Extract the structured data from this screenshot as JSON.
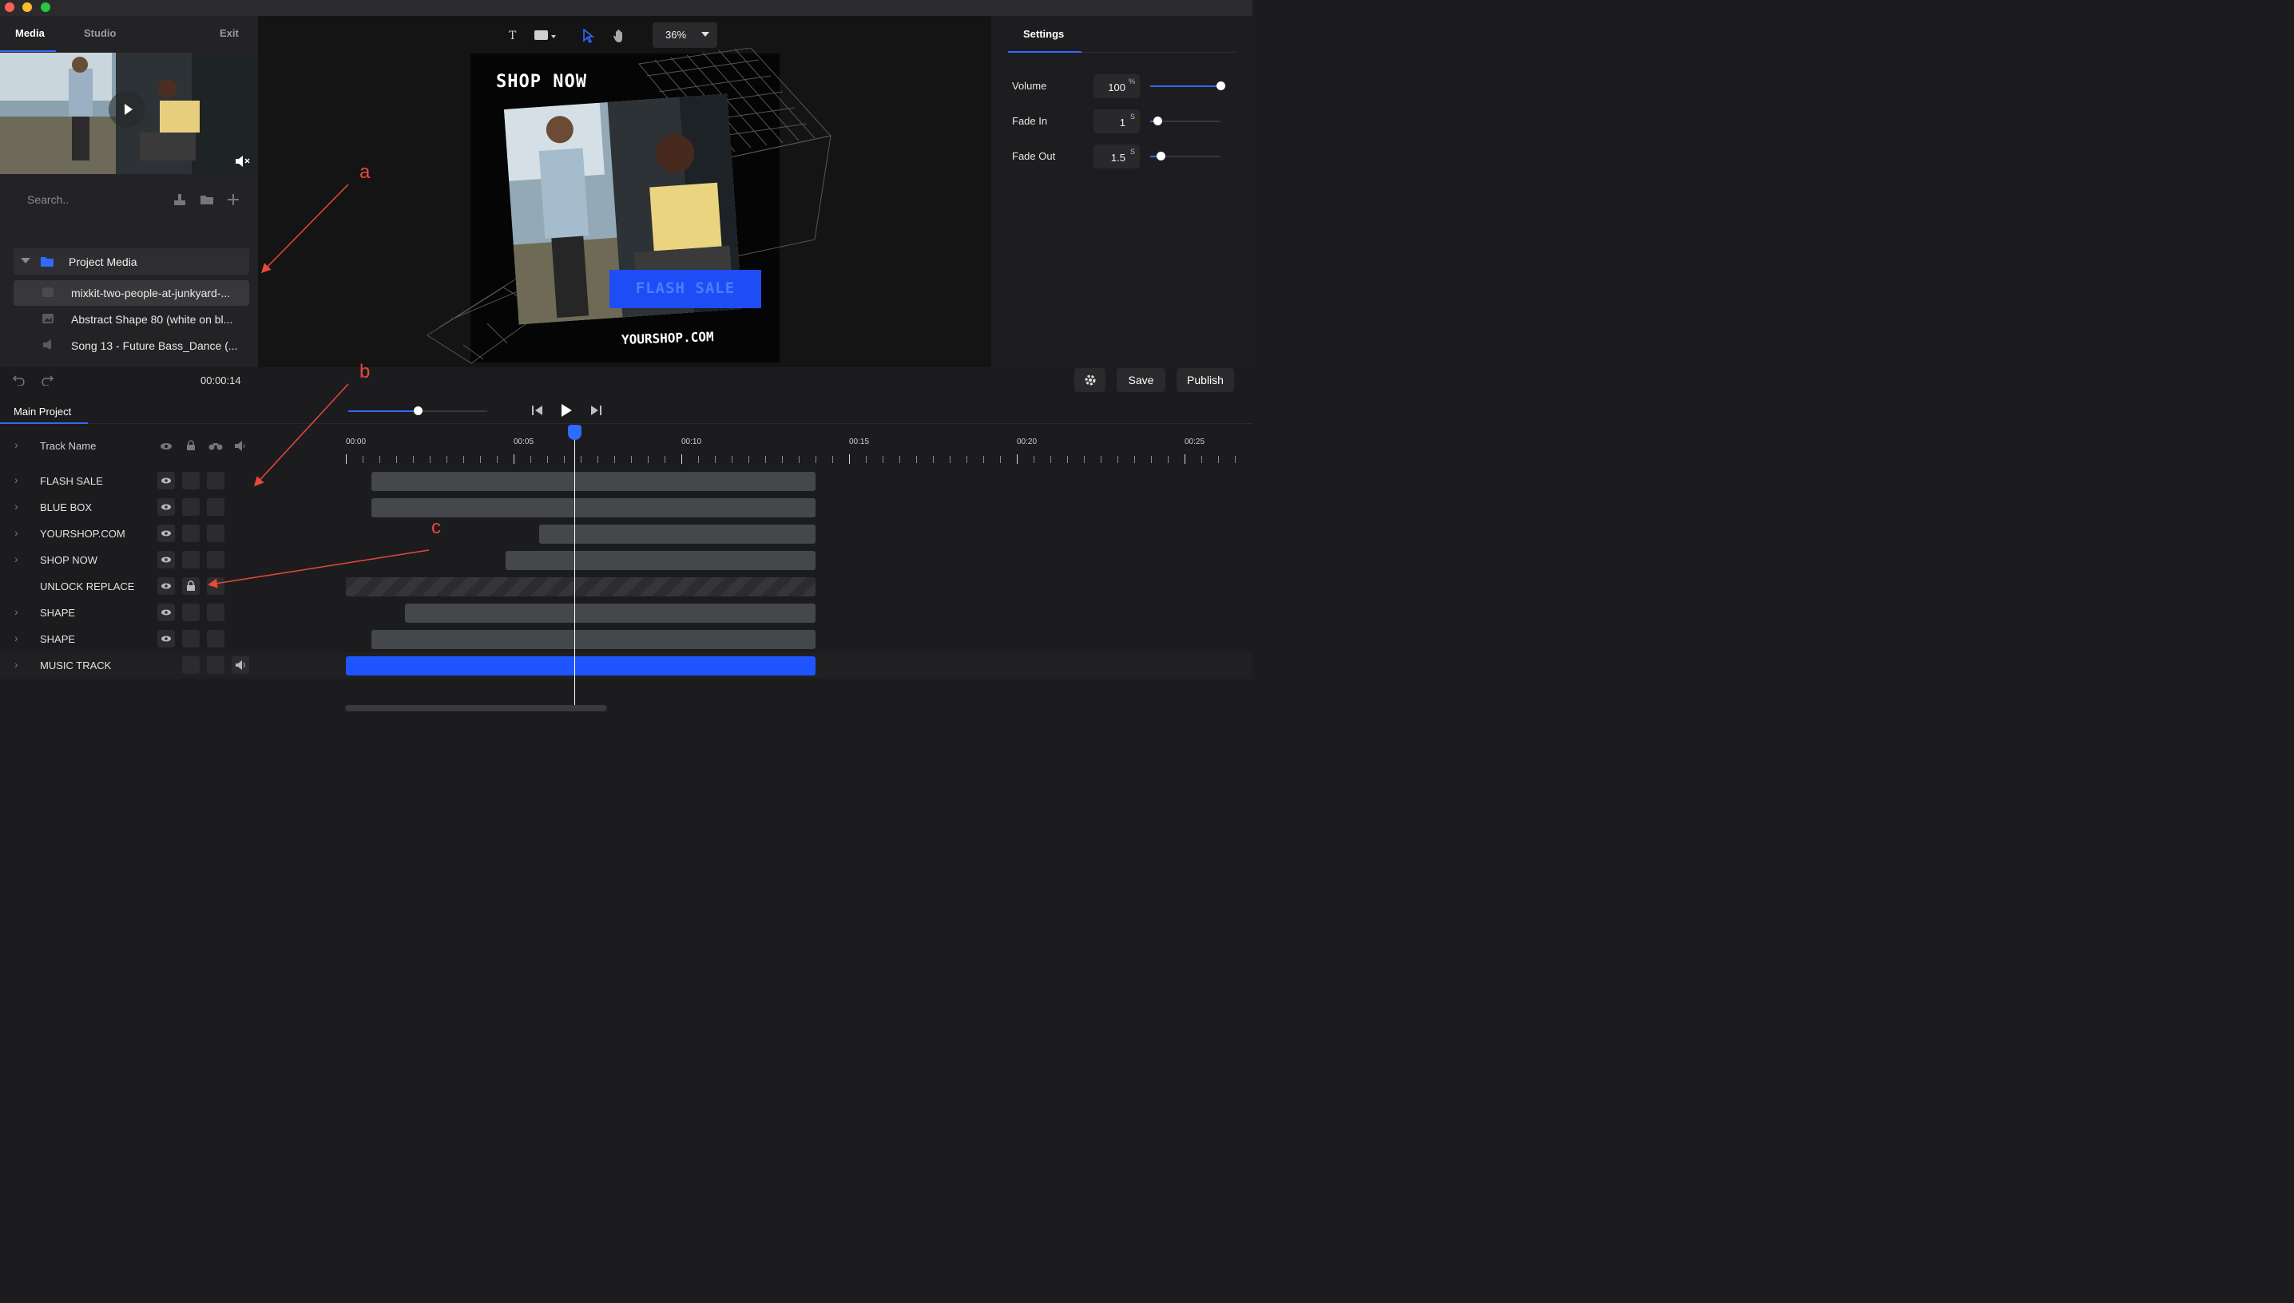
{
  "left_panel": {
    "tabs": [
      {
        "label": "Media"
      },
      {
        "label": "Studio"
      }
    ],
    "exit_label": "Exit",
    "search_placeholder": "Search..",
    "folder": {
      "label": "Project Media"
    },
    "files": [
      {
        "label": "mixkit-two-people-at-junkyard-...",
        "icon": "video-icon"
      },
      {
        "label": "Abstract Shape 80 (white on bl...",
        "icon": "image-icon"
      },
      {
        "label": "Song 13 - Future Bass_Dance (...",
        "icon": "audio-icon"
      }
    ]
  },
  "canvas": {
    "toolbar": {
      "text_tool": "T",
      "zoom": "36%"
    },
    "artboard": {
      "headline": "SHOP  NOW",
      "flash": "FLASH SALE",
      "url": "YOURSHOP.COM"
    }
  },
  "settings": {
    "tab": "Settings",
    "props": [
      {
        "label": "Volume",
        "value": "100",
        "unit": "%",
        "level": 1.0
      },
      {
        "label": "Fade In",
        "value": "1",
        "unit": "S",
        "level": 0.1
      },
      {
        "label": "Fade Out",
        "value": "1.5",
        "unit": "S",
        "level": 0.15
      }
    ]
  },
  "timeline": {
    "time": "00:00:14",
    "tab": "Main Project",
    "save_label": "Save",
    "publish_label": "Publish",
    "header_label": "Track Name",
    "zoom_level": 0.5,
    "ruler": [
      "00:00",
      "00:05",
      "00:10",
      "00:15",
      "00:20",
      "00:25"
    ],
    "playhead_seconds": 6.8,
    "tracks": [
      {
        "name": "FLASH SALE",
        "start": 0.75,
        "end": 14.0
      },
      {
        "name": "BLUE BOX",
        "start": 0.75,
        "end": 14.0
      },
      {
        "name": "YOURSHOP.COM",
        "start": 5.75,
        "end": 14.0
      },
      {
        "name": "SHOP NOW",
        "start": 4.75,
        "end": 14.0
      },
      {
        "name": "UNLOCK REPLACE",
        "start": 0.0,
        "end": 14.0,
        "locked": true
      },
      {
        "name": "SHAPE",
        "start": 1.75,
        "end": 14.0
      },
      {
        "name": "SHAPE",
        "start": 0.75,
        "end": 14.0
      },
      {
        "name": "MUSIC TRACK",
        "start": 0.0,
        "end": 14.0,
        "music": true
      }
    ]
  },
  "annotations": [
    "a",
    "b",
    "c"
  ],
  "colors": {
    "accent": "#2f6bff",
    "annotation": "#e8483a",
    "music_clip": "#1f55ff"
  }
}
